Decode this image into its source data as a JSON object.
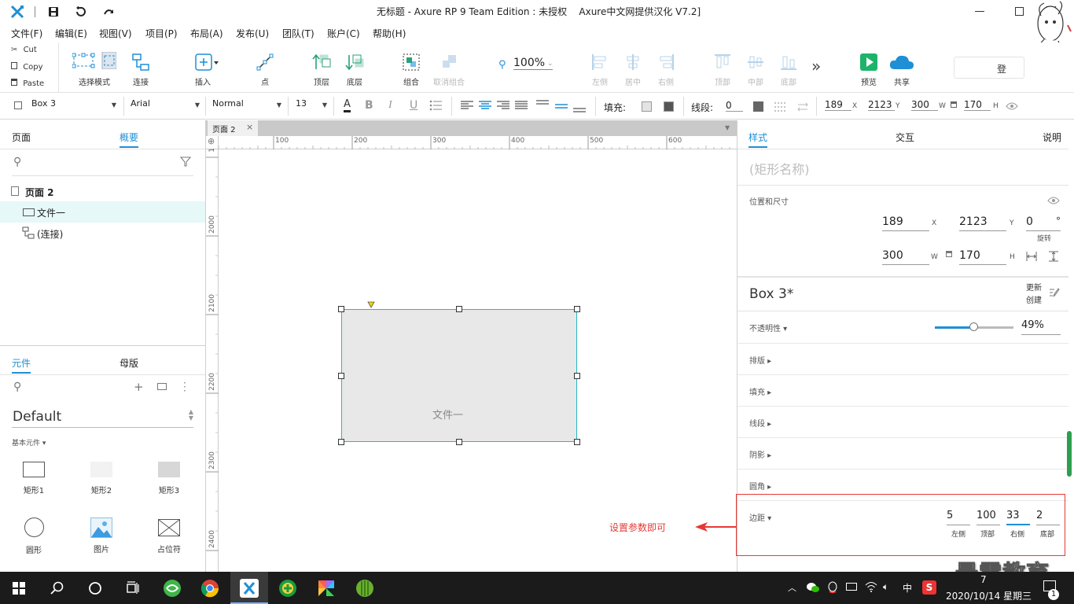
{
  "window": {
    "title": "无标题 - Axure RP 9 Team Edition : 未授权    Axure中文网提供汉化 V7.2]"
  },
  "menu": [
    "文件(F)",
    "编辑(E)",
    "视图(V)",
    "项目(P)",
    "布局(A)",
    "发布(U)",
    "团队(T)",
    "账户(C)",
    "帮助(H)"
  ],
  "clipboard": {
    "cut": "Cut",
    "copy": "Copy",
    "paste": "Paste"
  },
  "toolbar": {
    "select_mode": "选择模式",
    "connect": "连接",
    "insert": "插入",
    "point": "点",
    "top_layer": "顶层",
    "bottom_layer": "底层",
    "group": "组合",
    "ungroup": "取消组合",
    "zoom": "100%",
    "align_left": "左侧",
    "align_center": "居中",
    "align_right": "右侧",
    "align_top": "顶部",
    "align_middle": "中部",
    "align_bottom": "底部",
    "more": "»",
    "preview": "预览",
    "share": "共享",
    "login": "登"
  },
  "stylebar": {
    "style_name": "Box 3",
    "font": "Arial",
    "weight": "Normal",
    "size": "13",
    "fill_label": "填充:",
    "line_label": "线段:",
    "line_width": "0",
    "x": "189",
    "x_unit": "X",
    "y": "2123",
    "y_unit": "Y",
    "w": "300",
    "w_unit": "W",
    "h": "170",
    "h_unit": "H"
  },
  "left": {
    "tabs": [
      "页面",
      "概要"
    ],
    "active_tab": "概要",
    "outline": {
      "page": "页面 2",
      "items": [
        "文件一",
        "(连接)"
      ]
    },
    "lib_tabs": [
      "元件",
      "母版"
    ],
    "library": "Default",
    "category": "基本元件 ▾",
    "widgets": [
      "矩形1",
      "矩形2",
      "矩形3",
      "圆形",
      "图片",
      "占位符"
    ]
  },
  "canvas": {
    "tab": "页面 2",
    "ruler_h": [
      "100",
      "200",
      "300",
      "400",
      "500",
      "600"
    ],
    "ruler_v": [
      "1",
      "2000",
      "2100",
      "2200",
      "2300",
      "2400"
    ],
    "shape_text": "文件一",
    "annotation": "设置参数即可"
  },
  "right": {
    "tabs": [
      "样式",
      "交互",
      "说明"
    ],
    "active_tab": "样式",
    "name_placeholder": "(矩形名称)",
    "pos_title": "位置和尺寸",
    "x": "189",
    "y": "2123",
    "rot": "0",
    "deg": "°",
    "rot_label": "旋转",
    "w": "300",
    "h": "170",
    "x_unit": "X",
    "y_unit": "Y",
    "w_unit": "W",
    "h_unit": "H",
    "style_name": "Box 3*",
    "update": "更新",
    "create": "创建",
    "opacity_label": "不透明性 ▾",
    "opacity": 0.49,
    "opacity_text": "49%",
    "sections": [
      "排版 ▸",
      "填充 ▸",
      "线段 ▸",
      "阴影 ▸",
      "圆角 ▸"
    ],
    "padding_label": "边距 ▾",
    "padding": [
      {
        "value": "5",
        "label": "左侧"
      },
      {
        "value": "100",
        "label": "顶部"
      },
      {
        "value": "33",
        "label": "右侧"
      },
      {
        "value": "2",
        "label": "底部"
      }
    ]
  },
  "watermark": "最需教育",
  "taskbar": {
    "ime": "中",
    "time_partial": "7",
    "date": "2020/10/14 星期三",
    "notif_count": "1"
  },
  "colors": {
    "accent": "#1f8fd6",
    "selection": "#29b6c5",
    "annotation": "#e53935",
    "shape_fill": "#e8e8e8"
  }
}
